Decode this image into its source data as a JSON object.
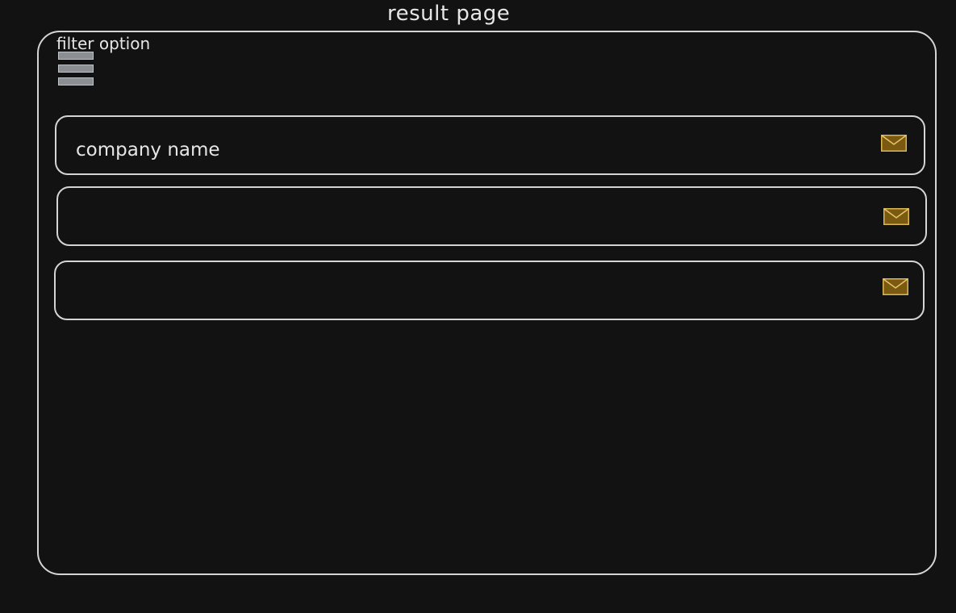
{
  "header": {
    "title": "result page"
  },
  "filter": {
    "label": "filter option",
    "icon": "hamburger-menu-icon"
  },
  "results": [
    {
      "company_name": "company name",
      "icon": "mail-icon"
    },
    {
      "company_name": "",
      "icon": "mail-icon"
    },
    {
      "company_name": "",
      "icon": "mail-icon"
    }
  ],
  "colors": {
    "background": "#121212",
    "stroke": "#d4d4d4",
    "mail_fill": "#7a5a10",
    "mail_stroke": "#d9b65a",
    "hamburger_fill": "#8b8f93"
  }
}
